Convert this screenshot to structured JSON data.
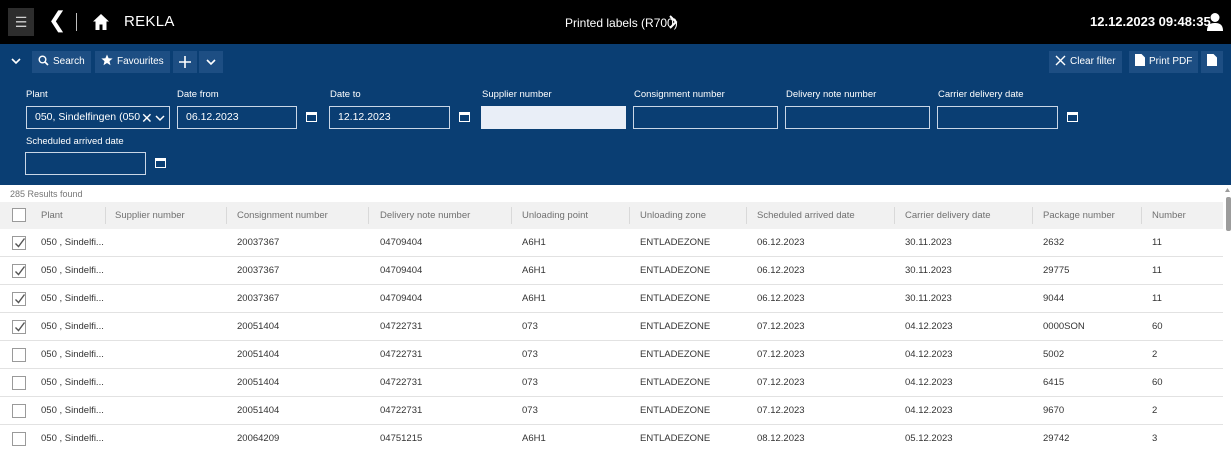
{
  "topbar": {
    "app_title": "REKLA",
    "page_title": "Printed labels (R700)",
    "datetime": "12.12.2023 09:48:35"
  },
  "toolbar": {
    "search_label": "Search",
    "favourites_label": "Favourites",
    "clear_filter_label": "Clear filter",
    "print_pdf_label": "Print PDF"
  },
  "filters": {
    "plant": {
      "label": "Plant",
      "value": "050, Sindelfingen (050"
    },
    "date_from": {
      "label": "Date from",
      "value": "06.12.2023"
    },
    "date_to": {
      "label": "Date to",
      "value": "12.12.2023"
    },
    "supplier_number": {
      "label": "Supplier number",
      "value": ""
    },
    "consignment_number": {
      "label": "Consignment number",
      "value": ""
    },
    "delivery_note_number": {
      "label": "Delivery note number",
      "value": ""
    },
    "carrier_delivery_date": {
      "label": "Carrier delivery date",
      "value": ""
    },
    "scheduled_arrived_date": {
      "label": "Scheduled arrived date",
      "value": ""
    }
  },
  "results": {
    "count_text": "285 Results found",
    "columns": [
      "Plant",
      "Supplier number",
      "Consignment number",
      "Delivery note number",
      "Unloading point",
      "Unloading zone",
      "Scheduled arrived date",
      "Carrier delivery date",
      "Package number",
      "Number"
    ],
    "rows": [
      {
        "checked": true,
        "cells": [
          "050 , Sindelfi...",
          "",
          "20037367",
          "04709404",
          "A6H1",
          "ENTLADEZONE",
          "06.12.2023",
          "30.11.2023",
          "2632",
          "11"
        ]
      },
      {
        "checked": true,
        "cells": [
          "050 , Sindelfi...",
          "",
          "20037367",
          "04709404",
          "A6H1",
          "ENTLADEZONE",
          "06.12.2023",
          "30.11.2023",
          "29775",
          "11"
        ]
      },
      {
        "checked": true,
        "cells": [
          "050 , Sindelfi...",
          "",
          "20037367",
          "04709404",
          "A6H1",
          "ENTLADEZONE",
          "06.12.2023",
          "30.11.2023",
          "9044",
          "11"
        ]
      },
      {
        "checked": true,
        "cells": [
          "050 , Sindelfi...",
          "",
          "20051404",
          "04722731",
          "073",
          "ENTLADEZONE",
          "07.12.2023",
          "04.12.2023",
          "0000SON",
          "60"
        ]
      },
      {
        "checked": false,
        "cells": [
          "050 , Sindelfi...",
          "",
          "20051404",
          "04722731",
          "073",
          "ENTLADEZONE",
          "07.12.2023",
          "04.12.2023",
          "5002",
          "2"
        ]
      },
      {
        "checked": false,
        "cells": [
          "050 , Sindelfi...",
          "",
          "20051404",
          "04722731",
          "073",
          "ENTLADEZONE",
          "07.12.2023",
          "04.12.2023",
          "6415",
          "60"
        ]
      },
      {
        "checked": false,
        "cells": [
          "050 , Sindelfi...",
          "",
          "20051404",
          "04722731",
          "073",
          "ENTLADEZONE",
          "07.12.2023",
          "04.12.2023",
          "9670",
          "2"
        ]
      },
      {
        "checked": false,
        "cells": [
          "050 , Sindelfi...",
          "",
          "20064209",
          "04751215",
          "A6H1",
          "ENTLADEZONE",
          "08.12.2023",
          "05.12.2023",
          "29742",
          "3"
        ]
      }
    ]
  },
  "colors": {
    "topbar_bg": "#000000",
    "filter_bg": "#0a3e73",
    "button_bg": "#1d4e83",
    "header_bg": "#f1f1f1"
  },
  "icons": [
    "menu-icon",
    "back-icon",
    "home-icon",
    "chevron-right-icon",
    "user-icon",
    "chevron-down-icon",
    "search-icon",
    "star-icon",
    "plus-icon",
    "close-icon",
    "document-icon",
    "calendar-icon",
    "checkbox-icon"
  ]
}
